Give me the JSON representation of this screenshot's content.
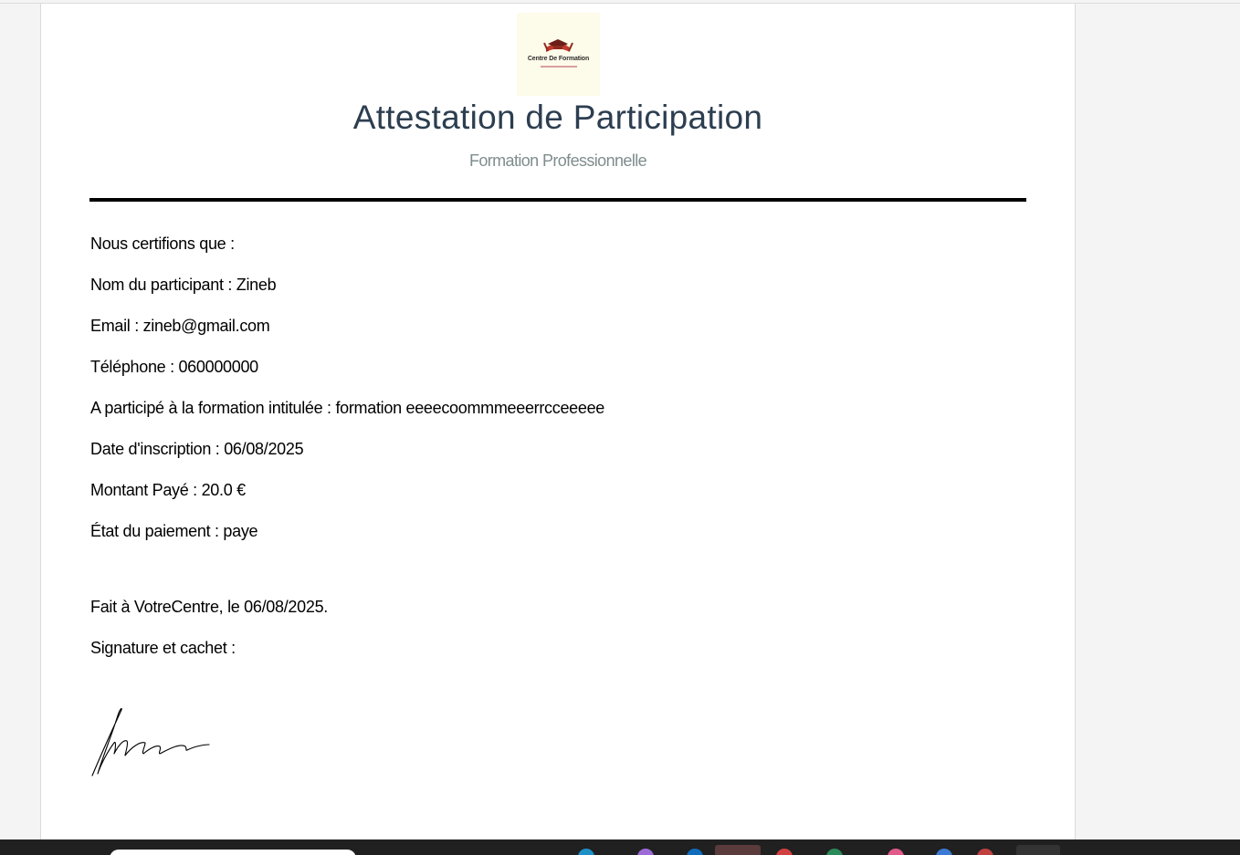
{
  "logo": {
    "text": "Centre De Formation"
  },
  "certificate": {
    "title": "Attestation de Participation",
    "subtitle": "Formation Professionnelle",
    "intro": "Nous certifions que :",
    "participant_name": "Nom du participant : Zineb",
    "email": "Email : zineb@gmail.com",
    "phone": "Téléphone : 060000000",
    "training": "A participé à la formation intitulée : formation eeeecoommmeeerrcceeeee",
    "registration_date": "Date d'inscription : 06/08/2025",
    "amount_paid": "Montant Payé : 20.0 €",
    "payment_status": "État du paiement : paye",
    "place_date": "Fait à VotreCentre, le 06/08/2025.",
    "signature_label": "Signature et cachet :"
  },
  "colors": {
    "title": "#2c3e50",
    "subtitle": "#7f8c8d",
    "logo_background": "#fdfbe9",
    "logo_accent": "#b03030",
    "taskbar": "#202020"
  },
  "taskbar": {
    "icons": [
      "search-box",
      "edge-icon",
      "copilot-icon",
      "outlook-icon",
      "app-icon",
      "chrome-icon",
      "app-icon",
      "app-icon",
      "app-icon",
      "terminal-icon"
    ]
  }
}
